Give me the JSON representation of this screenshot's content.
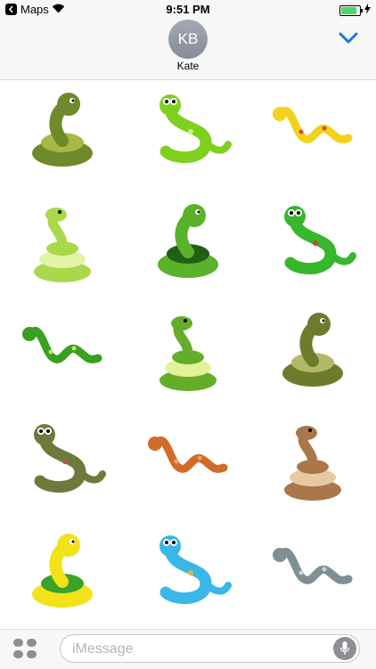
{
  "status_bar": {
    "back_app": "Maps",
    "time": "9:51 PM",
    "battery_level": 0.85
  },
  "header": {
    "avatar_initials": "KB",
    "contact_name": "Kate"
  },
  "stickers": [
    {
      "name": "olive-snake-sticker",
      "colors": [
        "#6f8a2a",
        "#a7b845"
      ]
    },
    {
      "name": "green-cartoon-snake-sticker",
      "colors": [
        "#7fcf1f",
        "#d2f27a"
      ]
    },
    {
      "name": "yellow-snake-sticker",
      "colors": [
        "#f2d21a",
        "#d94b2b"
      ]
    },
    {
      "name": "light-green-coiled-snake-sticker",
      "colors": [
        "#a9d84a",
        "#e3f3a6"
      ]
    },
    {
      "name": "green-spotted-snake-sticker",
      "colors": [
        "#58b22a",
        "#1f5f16"
      ]
    },
    {
      "name": "green-hooded-snake-sticker",
      "colors": [
        "#37b62e",
        "#c34a2f"
      ]
    },
    {
      "name": "green-rattlesnake-sticker",
      "colors": [
        "#3aa01f",
        "#c7e86f"
      ]
    },
    {
      "name": "green-snake-tongue-sticker",
      "colors": [
        "#64ad2a",
        "#e3f199"
      ]
    },
    {
      "name": "olive-coiled-snake-sticker",
      "colors": [
        "#6d7c2c",
        "#b3b968"
      ]
    },
    {
      "name": "brown-rattlesnake-sticker",
      "colors": [
        "#6e7a3b",
        "#b05a47"
      ]
    },
    {
      "name": "orange-snake-pair-sticker",
      "colors": [
        "#d06c2a",
        "#f0a268"
      ]
    },
    {
      "name": "brown-cobra-sticker",
      "colors": [
        "#a9774a",
        "#e7c9a1"
      ]
    },
    {
      "name": "snake-couple-heart-sticker",
      "colors": [
        "#f2e21a",
        "#3aa32a"
      ]
    },
    {
      "name": "blue-snake-sticker",
      "colors": [
        "#3ab7e6",
        "#e2b14a"
      ]
    },
    {
      "name": "grey-cobra-sticker",
      "colors": [
        "#7f8f94",
        "#c9d5d6"
      ]
    }
  ],
  "composer": {
    "placeholder": "iMessage"
  },
  "icons": {
    "back": "back-arrow-icon",
    "wifi": "wifi-icon",
    "battery": "battery-icon",
    "charging": "charging-bolt-icon",
    "collapse": "chevron-down-icon",
    "apps": "apps-icon",
    "mic": "microphone-icon"
  },
  "colors": {
    "accent": "#1a73e8",
    "bar_bg": "#f7f7f7",
    "battery_fill": "#4cd964"
  }
}
